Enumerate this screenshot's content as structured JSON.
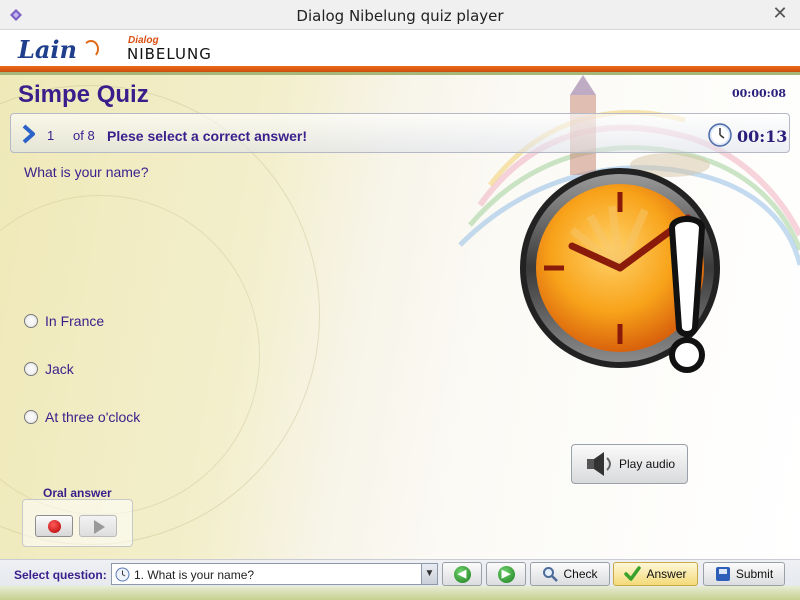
{
  "window": {
    "title": "Dialog Nibelung quiz player",
    "close_glyph": "✕"
  },
  "branding": {
    "logo_main": "Lain",
    "logo_small": "Dialog",
    "logo_product": "NIBELUNG"
  },
  "quiz": {
    "title": "Simpe Quiz",
    "total_time": "00:00:08",
    "question_number": "1",
    "question_of": "of 8",
    "prompt": "Plese select a correct answer!",
    "question_timer": "00:13",
    "question_text": "What is your name?",
    "options": [
      {
        "label": "In France",
        "selected": false
      },
      {
        "label": "Jack",
        "selected": false
      },
      {
        "label": "At three o'clock",
        "selected": false
      }
    ]
  },
  "media": {
    "play_audio_label": "Play audio",
    "icon": "speaker-icon"
  },
  "oral_answer": {
    "label": "Oral answer",
    "record_icon": "record-icon",
    "play_icon": "play-icon"
  },
  "footer": {
    "select_label": "Select question:",
    "selected_question": "1. What is your name?",
    "prev_glyph": "◀",
    "next_glyph": "▶",
    "check_label": "Check",
    "answer_label": "Answer",
    "submit_label": "Submit"
  },
  "colors": {
    "accent_text": "#3a1f8c",
    "header_stripe": "#f06a17",
    "alarm_face": "#f6a214"
  }
}
